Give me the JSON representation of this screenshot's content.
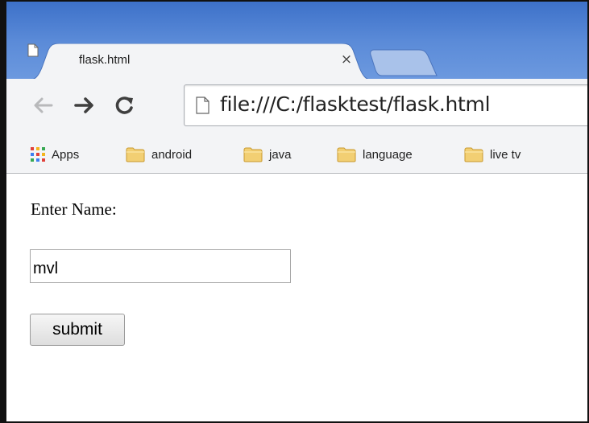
{
  "tab": {
    "title": "flask.html",
    "page_icon": "page-icon",
    "close_glyph": "×"
  },
  "toolbar": {
    "back_icon": "back-arrow-icon",
    "forward_icon": "forward-arrow-icon",
    "reload_icon": "reload-icon",
    "url": "file:///C:/flasktest/flask.html"
  },
  "bookmarks": {
    "apps_label": "Apps",
    "folders": [
      "android",
      "java",
      "language",
      "live tv"
    ]
  },
  "form": {
    "label": "Enter Name:",
    "input_value": "mvl",
    "submit_label": "submit"
  },
  "colors": {
    "tabstrip": "#5b8bd8",
    "new_tab": "#a9c2ea",
    "toolbar": "#f3f4f6",
    "folder": "#f2cf73"
  }
}
